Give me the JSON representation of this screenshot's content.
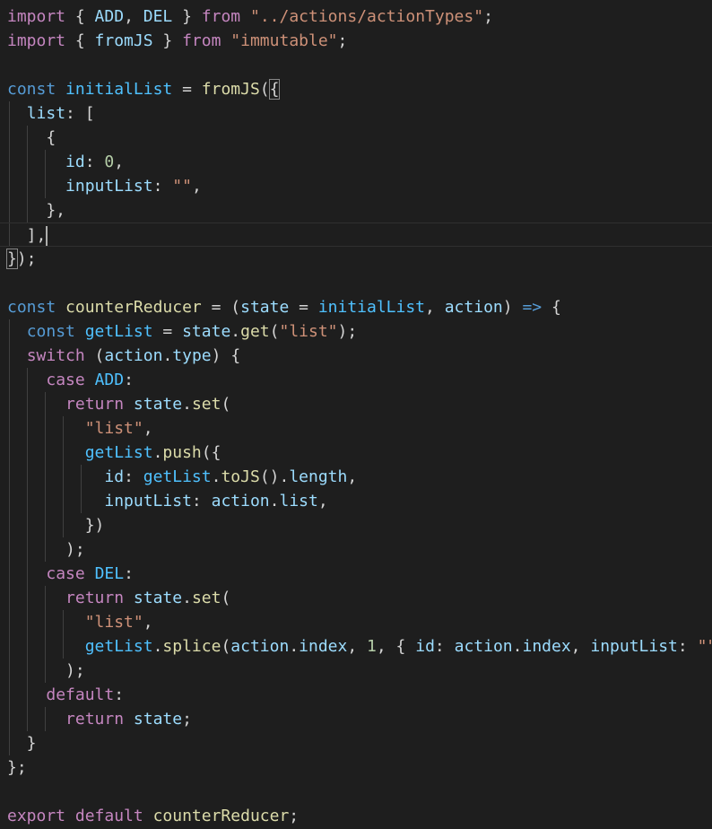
{
  "editor": {
    "language": "javascript",
    "theme_colors": {
      "background": "#1e1e1e",
      "keyword": "#c586c0",
      "storage": "#569cd6",
      "variable": "#9cdcfe",
      "constant": "#4fc1ff",
      "function": "#dcdcaa",
      "string": "#ce9178",
      "number": "#b5cea8",
      "punctuation": "#d4d4d4"
    },
    "lines": [
      [
        [
          "kw",
          "import"
        ],
        [
          "pn",
          " { "
        ],
        [
          "vr",
          "ADD"
        ],
        [
          "pn",
          ", "
        ],
        [
          "vr",
          "DEL"
        ],
        [
          "pn",
          " } "
        ],
        [
          "kw",
          "from"
        ],
        [
          "pn",
          " "
        ],
        [
          "str",
          "\"../actions/actionTypes\""
        ],
        [
          "pn",
          ";"
        ]
      ],
      [
        [
          "kw",
          "import"
        ],
        [
          "pn",
          " { "
        ],
        [
          "vr",
          "fromJS"
        ],
        [
          "pn",
          " } "
        ],
        [
          "kw",
          "from"
        ],
        [
          "pn",
          " "
        ],
        [
          "str",
          "\"immutable\""
        ],
        [
          "pn",
          ";"
        ]
      ],
      [],
      [
        [
          "st",
          "const"
        ],
        [
          "pn",
          " "
        ],
        [
          "ct",
          "initialList"
        ],
        [
          "pn",
          " = "
        ],
        [
          "fn",
          "fromJS"
        ],
        [
          "pn",
          "("
        ],
        [
          "bm",
          "{"
        ]
      ],
      [
        [
          "pn",
          "  "
        ],
        [
          "vr",
          "list"
        ],
        [
          "pn",
          ": ["
        ]
      ],
      [
        [
          "pn",
          "    {"
        ]
      ],
      [
        [
          "pn",
          "      "
        ],
        [
          "vr",
          "id"
        ],
        [
          "pn",
          ": "
        ],
        [
          "num",
          "0"
        ],
        [
          "pn",
          ","
        ]
      ],
      [
        [
          "pn",
          "      "
        ],
        [
          "vr",
          "inputList"
        ],
        [
          "pn",
          ": "
        ],
        [
          "str",
          "\"\""
        ],
        [
          "pn",
          ","
        ]
      ],
      [
        [
          "pn",
          "    },"
        ]
      ],
      [
        [
          "pn",
          "  ],"
        ],
        [
          "cursor",
          ""
        ]
      ],
      [
        [
          "bm",
          "}"
        ],
        [
          "pn",
          ");"
        ]
      ],
      [],
      [
        [
          "st",
          "const"
        ],
        [
          "pn",
          " "
        ],
        [
          "fn",
          "counterReducer"
        ],
        [
          "pn",
          " = ("
        ],
        [
          "vr",
          "state"
        ],
        [
          "pn",
          " = "
        ],
        [
          "ct",
          "initialList"
        ],
        [
          "pn",
          ", "
        ],
        [
          "vr",
          "action"
        ],
        [
          "pn",
          ") "
        ],
        [
          "st",
          "=>"
        ],
        [
          "pn",
          " {"
        ]
      ],
      [
        [
          "pn",
          "  "
        ],
        [
          "st",
          "const"
        ],
        [
          "pn",
          " "
        ],
        [
          "ct",
          "getList"
        ],
        [
          "pn",
          " = "
        ],
        [
          "vr",
          "state"
        ],
        [
          "pn",
          "."
        ],
        [
          "fn",
          "get"
        ],
        [
          "pn",
          "("
        ],
        [
          "str",
          "\"list\""
        ],
        [
          "pn",
          ");"
        ]
      ],
      [
        [
          "pn",
          "  "
        ],
        [
          "kw",
          "switch"
        ],
        [
          "pn",
          " ("
        ],
        [
          "vr",
          "action"
        ],
        [
          "pn",
          "."
        ],
        [
          "vr",
          "type"
        ],
        [
          "pn",
          ") {"
        ]
      ],
      [
        [
          "pn",
          "    "
        ],
        [
          "kw",
          "case"
        ],
        [
          "pn",
          " "
        ],
        [
          "ct",
          "ADD"
        ],
        [
          "pn",
          ":"
        ]
      ],
      [
        [
          "pn",
          "      "
        ],
        [
          "kw",
          "return"
        ],
        [
          "pn",
          " "
        ],
        [
          "vr",
          "state"
        ],
        [
          "pn",
          "."
        ],
        [
          "fn",
          "set"
        ],
        [
          "pn",
          "("
        ]
      ],
      [
        [
          "pn",
          "        "
        ],
        [
          "str",
          "\"list\""
        ],
        [
          "pn",
          ","
        ]
      ],
      [
        [
          "pn",
          "        "
        ],
        [
          "ct",
          "getList"
        ],
        [
          "pn",
          "."
        ],
        [
          "fn",
          "push"
        ],
        [
          "pn",
          "({"
        ]
      ],
      [
        [
          "pn",
          "          "
        ],
        [
          "vr",
          "id"
        ],
        [
          "pn",
          ": "
        ],
        [
          "ct",
          "getList"
        ],
        [
          "pn",
          "."
        ],
        [
          "fn",
          "toJS"
        ],
        [
          "pn",
          "()."
        ],
        [
          "vr",
          "length"
        ],
        [
          "pn",
          ","
        ]
      ],
      [
        [
          "pn",
          "          "
        ],
        [
          "vr",
          "inputList"
        ],
        [
          "pn",
          ": "
        ],
        [
          "vr",
          "action"
        ],
        [
          "pn",
          "."
        ],
        [
          "vr",
          "list"
        ],
        [
          "pn",
          ","
        ]
      ],
      [
        [
          "pn",
          "        })"
        ]
      ],
      [
        [
          "pn",
          "      );"
        ]
      ],
      [
        [
          "pn",
          "    "
        ],
        [
          "kw",
          "case"
        ],
        [
          "pn",
          " "
        ],
        [
          "ct",
          "DEL"
        ],
        [
          "pn",
          ":"
        ]
      ],
      [
        [
          "pn",
          "      "
        ],
        [
          "kw",
          "return"
        ],
        [
          "pn",
          " "
        ],
        [
          "vr",
          "state"
        ],
        [
          "pn",
          "."
        ],
        [
          "fn",
          "set"
        ],
        [
          "pn",
          "("
        ]
      ],
      [
        [
          "pn",
          "        "
        ],
        [
          "str",
          "\"list\""
        ],
        [
          "pn",
          ","
        ]
      ],
      [
        [
          "pn",
          "        "
        ],
        [
          "ct",
          "getList"
        ],
        [
          "pn",
          "."
        ],
        [
          "fn",
          "splice"
        ],
        [
          "pn",
          "("
        ],
        [
          "vr",
          "action"
        ],
        [
          "pn",
          "."
        ],
        [
          "vr",
          "index"
        ],
        [
          "pn",
          ", "
        ],
        [
          "num",
          "1"
        ],
        [
          "pn",
          ", { "
        ],
        [
          "vr",
          "id"
        ],
        [
          "pn",
          ": "
        ],
        [
          "vr",
          "action"
        ],
        [
          "pn",
          "."
        ],
        [
          "vr",
          "index"
        ],
        [
          "pn",
          ", "
        ],
        [
          "vr",
          "inputList"
        ],
        [
          "pn",
          ": "
        ],
        [
          "str",
          "\"\""
        ],
        [
          "pn",
          " })"
        ]
      ],
      [
        [
          "pn",
          "      );"
        ]
      ],
      [
        [
          "pn",
          "    "
        ],
        [
          "kw",
          "default"
        ],
        [
          "pn",
          ":"
        ]
      ],
      [
        [
          "pn",
          "      "
        ],
        [
          "kw",
          "return"
        ],
        [
          "pn",
          " "
        ],
        [
          "vr",
          "state"
        ],
        [
          "pn",
          ";"
        ]
      ],
      [
        [
          "pn",
          "  }"
        ]
      ],
      [
        [
          "pn",
          "};"
        ]
      ],
      [],
      [
        [
          "kw",
          "export"
        ],
        [
          "pn",
          " "
        ],
        [
          "kw",
          "default"
        ],
        [
          "pn",
          " "
        ],
        [
          "fn",
          "counterReducer"
        ],
        [
          "pn",
          ";"
        ]
      ]
    ]
  }
}
